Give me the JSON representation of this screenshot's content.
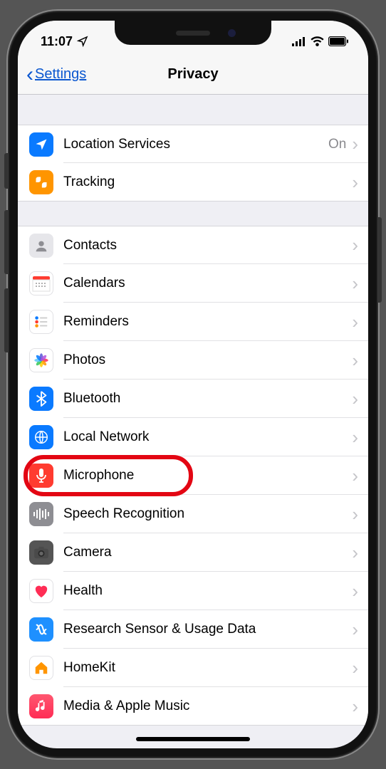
{
  "status": {
    "time": "11:07"
  },
  "nav": {
    "back": "Settings",
    "title": "Privacy"
  },
  "group1": [
    {
      "name": "location-services",
      "label": "Location Services",
      "detail": "On",
      "icon": "location",
      "bg": "bg-blue"
    },
    {
      "name": "tracking",
      "label": "Tracking",
      "detail": "",
      "icon": "tracking",
      "bg": "bg-orange"
    }
  ],
  "group2": [
    {
      "name": "contacts",
      "label": "Contacts",
      "icon": "contacts",
      "bg": "bg-grayimg"
    },
    {
      "name": "calendars",
      "label": "Calendars",
      "icon": "calendar",
      "bg": "bg-white"
    },
    {
      "name": "reminders",
      "label": "Reminders",
      "icon": "reminders",
      "bg": "bg-white"
    },
    {
      "name": "photos",
      "label": "Photos",
      "icon": "photos",
      "bg": "bg-white"
    },
    {
      "name": "bluetooth",
      "label": "Bluetooth",
      "icon": "bluetooth",
      "bg": "bg-blue"
    },
    {
      "name": "local-network",
      "label": "Local Network",
      "icon": "globe",
      "bg": "bg-globe"
    },
    {
      "name": "microphone",
      "label": "Microphone",
      "icon": "mic",
      "bg": "bg-red",
      "highlighted": true
    },
    {
      "name": "speech-recognition",
      "label": "Speech Recognition",
      "icon": "waveform",
      "bg": "bg-gray"
    },
    {
      "name": "camera",
      "label": "Camera",
      "icon": "camera",
      "bg": "bg-darkgray"
    },
    {
      "name": "health",
      "label": "Health",
      "icon": "heart",
      "bg": "bg-heart"
    },
    {
      "name": "research",
      "label": "Research Sensor & Usage Data",
      "icon": "research",
      "bg": "bg-research"
    },
    {
      "name": "homekit",
      "label": "HomeKit",
      "icon": "home",
      "bg": "bg-home"
    },
    {
      "name": "media",
      "label": "Media & Apple Music",
      "icon": "music",
      "bg": "bg-music"
    }
  ]
}
